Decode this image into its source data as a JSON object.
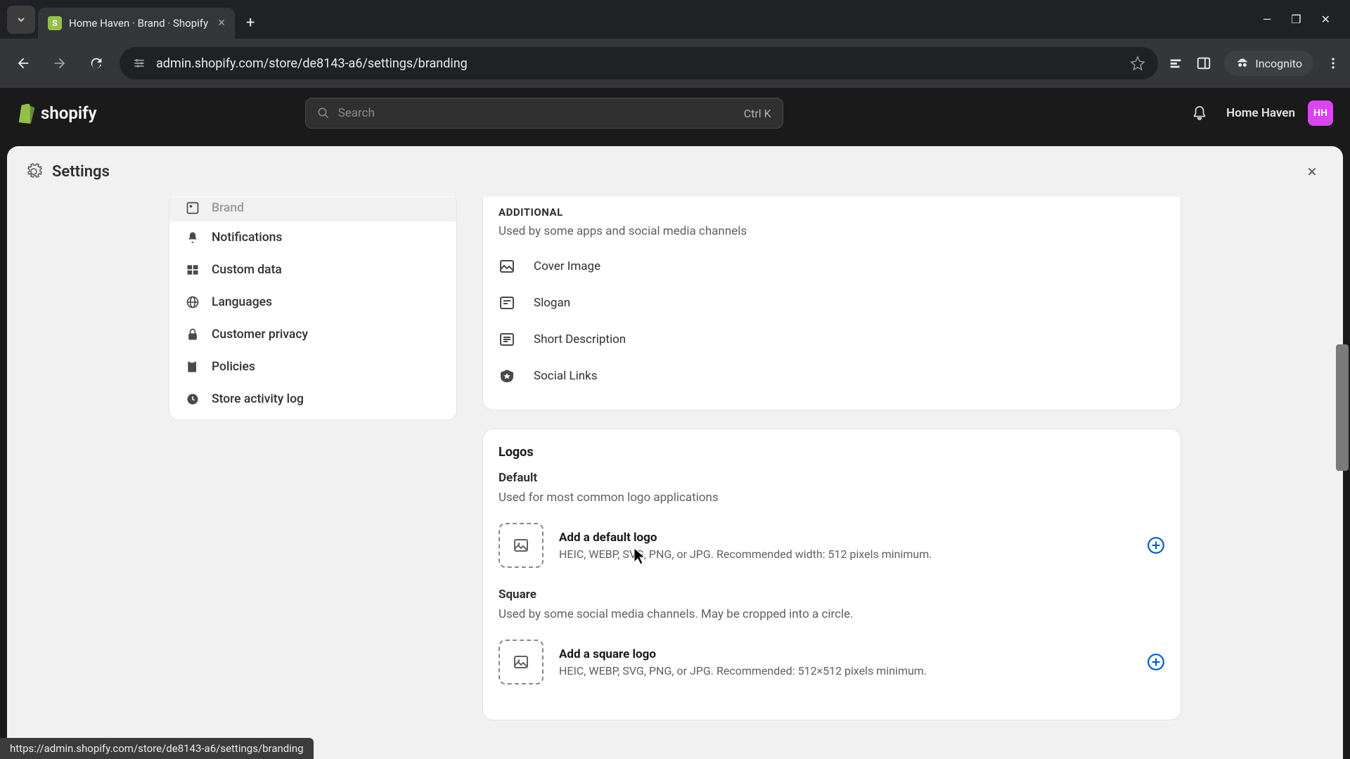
{
  "browser": {
    "tab_title": "Home Haven · Brand · Shopify",
    "url": "admin.shopify.com/store/de8143-a6/settings/branding",
    "incognito_label": "Incognito"
  },
  "shopify_header": {
    "logo_text": "shopify",
    "search_placeholder": "Search",
    "search_shortcut": "Ctrl K",
    "store_name": "Home Haven",
    "avatar_initials": "HH"
  },
  "settings": {
    "title": "Settings",
    "sidebar": [
      {
        "label": "Brand",
        "icon": "brand"
      },
      {
        "label": "Notifications",
        "icon": "bell"
      },
      {
        "label": "Custom data",
        "icon": "data"
      },
      {
        "label": "Languages",
        "icon": "globe"
      },
      {
        "label": "Customer privacy",
        "icon": "lock"
      },
      {
        "label": "Policies",
        "icon": "policy"
      },
      {
        "label": "Store activity log",
        "icon": "activity"
      }
    ],
    "additional": {
      "title": "ADDITIONAL",
      "desc": "Used by some apps and social media channels",
      "options": [
        {
          "label": "Cover Image",
          "icon": "image"
        },
        {
          "label": "Slogan",
          "icon": "text"
        },
        {
          "label": "Short Description",
          "icon": "desc"
        },
        {
          "label": "Social Links",
          "icon": "social"
        }
      ]
    },
    "logos": {
      "heading": "Logos",
      "default": {
        "title": "Default",
        "desc": "Used for most common logo applications",
        "upload_title": "Add a default logo",
        "upload_hint": "HEIC, WEBP, SVG, PNG, or JPG. Recommended width: 512 pixels minimum."
      },
      "square": {
        "title": "Square",
        "desc": "Used by some social media channels. May be cropped into a circle.",
        "upload_title": "Add a square logo",
        "upload_hint": "HEIC, WEBP, SVG, PNG, or JPG. Recommended: 512×512 pixels minimum."
      }
    }
  },
  "status_url": "https://admin.shopify.com/store/de8143-a6/settings/branding"
}
